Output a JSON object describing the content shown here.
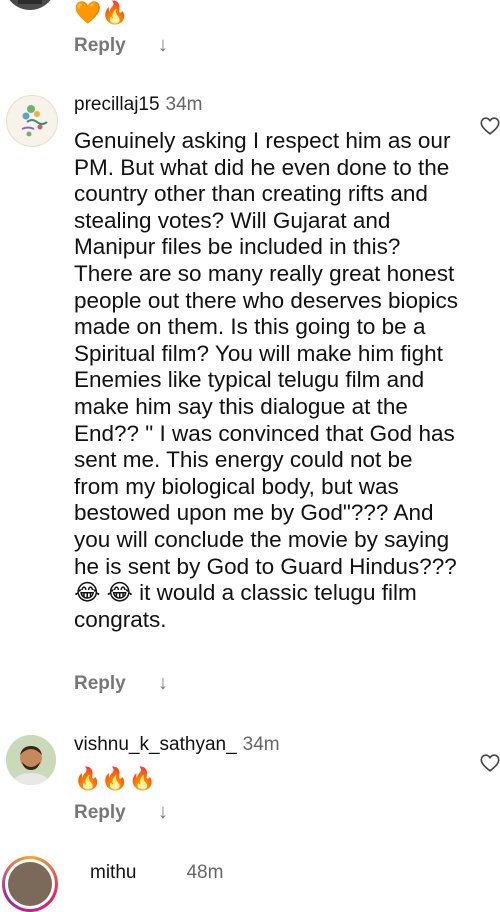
{
  "top_comment": {
    "emojis": "🧡🔥",
    "reply_label": "Reply",
    "more_replies_icon": "arrow-down-icon"
  },
  "comments": [
    {
      "username": "precillaj15",
      "time": "34m",
      "text": "Genuinely asking I respect him as our PM. But what did he even done to the country other than creating rifts and stealing votes? Will Gujarat and Manipur files be included in this? There are so many really great honest people out there who deserves biopics made on them. Is this going to be a Spiritual film? You will make him fight Enemies like typical telugu film and make him say this dialogue at the End?? \" I was convinced that God has sent me. This energy could not be from my biological body, but was bestowed upon me by God\"??? And you will conclude the movie by saying he is sent by God to Guard Hindus??? 😂 😂 it would a classic telugu film congrats.",
      "reply_label": "Reply",
      "like_icon": "heart-outline-icon"
    },
    {
      "username": "vishnu_k_sathyan_",
      "time": "34m",
      "text": "🔥🔥🔥",
      "reply_label": "Reply",
      "like_icon": "heart-outline-icon"
    },
    {
      "username": "mithu",
      "time": "48m"
    }
  ]
}
